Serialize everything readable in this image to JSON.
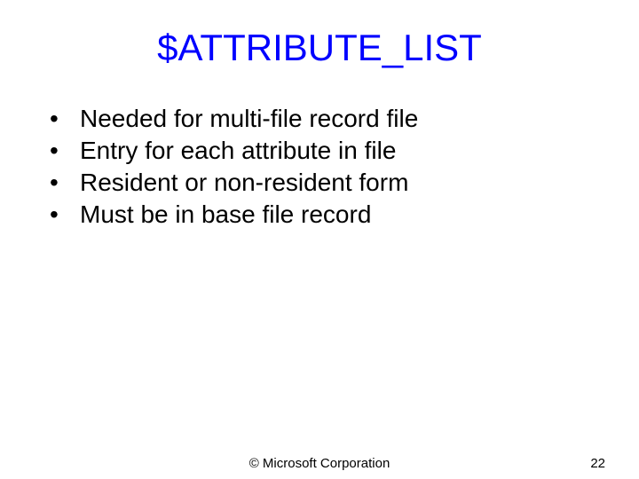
{
  "title": "$ATTRIBUTE_LIST",
  "bullets": [
    {
      "marker": "•",
      "text": "Needed for multi-file record file"
    },
    {
      "marker": "•",
      "text": "Entry for each attribute in file"
    },
    {
      "marker": "•",
      "text": "Resident or non-resident form"
    },
    {
      "marker": "•",
      "text": "Must be in base file record"
    }
  ],
  "footer": {
    "copyright": "© Microsoft Corporation",
    "page": "22"
  }
}
